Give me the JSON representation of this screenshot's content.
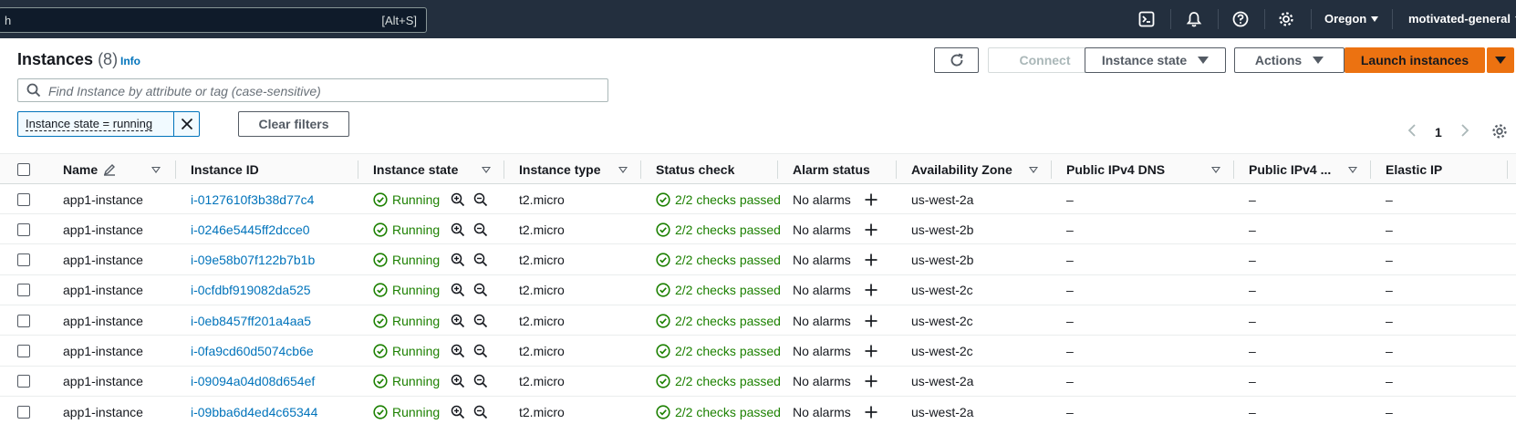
{
  "topnav": {
    "search_value": "h",
    "search_shortcut": "[Alt+S]",
    "icons": [
      "cloudshell-icon",
      "bell-icon",
      "help-icon",
      "gear-icon"
    ],
    "region": "Oregon",
    "account": "motivated-general"
  },
  "header": {
    "title": "Instances",
    "count": "(8)",
    "info": "Info"
  },
  "toolbar": {
    "connect": "Connect",
    "instance_state": "Instance state",
    "actions": "Actions",
    "launch": "Launch instances"
  },
  "filter": {
    "placeholder": "Find Instance by attribute or tag (case-sensitive)",
    "token": "Instance state = running",
    "clear": "Clear filters"
  },
  "pagination": {
    "page": "1"
  },
  "columns": [
    "Name",
    "Instance ID",
    "Instance state",
    "Instance type",
    "Status check",
    "Alarm status",
    "Availability Zone",
    "Public IPv4 DNS",
    "Public IPv4 ...",
    "Elastic IP"
  ],
  "rows": [
    {
      "name": "app1-instance",
      "id": "i-0127610f3b38d77c4",
      "state": "Running",
      "type": "t2.micro",
      "status": "2/2 checks passed",
      "alarm": "No alarms",
      "az": "us-west-2a",
      "dns": "–",
      "ipv4": "–",
      "eip": "–"
    },
    {
      "name": "app1-instance",
      "id": "i-0246e5445ff2dcce0",
      "state": "Running",
      "type": "t2.micro",
      "status": "2/2 checks passed",
      "alarm": "No alarms",
      "az": "us-west-2b",
      "dns": "–",
      "ipv4": "–",
      "eip": "–"
    },
    {
      "name": "app1-instance",
      "id": "i-09e58b07f122b7b1b",
      "state": "Running",
      "type": "t2.micro",
      "status": "2/2 checks passed",
      "alarm": "No alarms",
      "az": "us-west-2b",
      "dns": "–",
      "ipv4": "–",
      "eip": "–"
    },
    {
      "name": "app1-instance",
      "id": "i-0cfdbf919082da525",
      "state": "Running",
      "type": "t2.micro",
      "status": "2/2 checks passed",
      "alarm": "No alarms",
      "az": "us-west-2c",
      "dns": "–",
      "ipv4": "–",
      "eip": "–"
    },
    {
      "name": "app1-instance",
      "id": "i-0eb8457ff201a4aa5",
      "state": "Running",
      "type": "t2.micro",
      "status": "2/2 checks passed",
      "alarm": "No alarms",
      "az": "us-west-2c",
      "dns": "–",
      "ipv4": "–",
      "eip": "–"
    },
    {
      "name": "app1-instance",
      "id": "i-0fa9cd60d5074cb6e",
      "state": "Running",
      "type": "t2.micro",
      "status": "2/2 checks passed",
      "alarm": "No alarms",
      "az": "us-west-2c",
      "dns": "–",
      "ipv4": "–",
      "eip": "–"
    },
    {
      "name": "app1-instance",
      "id": "i-09094a04d08d654ef",
      "state": "Running",
      "type": "t2.micro",
      "status": "2/2 checks passed",
      "alarm": "No alarms",
      "az": "us-west-2a",
      "dns": "–",
      "ipv4": "–",
      "eip": "–"
    },
    {
      "name": "app1-instance",
      "id": "i-09bba6d4ed4c65344",
      "state": "Running",
      "type": "t2.micro",
      "status": "2/2 checks passed",
      "alarm": "No alarms",
      "az": "us-west-2a",
      "dns": "–",
      "ipv4": "–",
      "eip": "–"
    }
  ],
  "colors": {
    "nav_bg": "#232f3e",
    "link": "#0073bb",
    "success": "#1d8102",
    "primary": "#ec7211"
  }
}
